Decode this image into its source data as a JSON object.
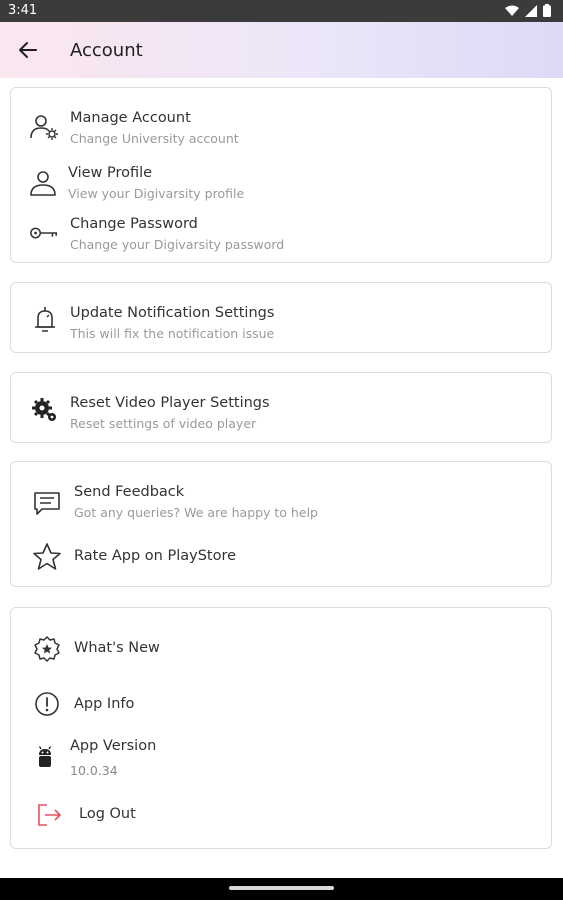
{
  "status": {
    "time": "3:41"
  },
  "header": {
    "title": "Account"
  },
  "account": {
    "items": [
      {
        "title": "Manage Account",
        "subtitle": "Change University account"
      },
      {
        "title": "View Profile",
        "subtitle": "View your Digivarsity profile"
      },
      {
        "title": "Change Password",
        "subtitle": "Change your Digivarsity password"
      }
    ]
  },
  "notification": {
    "title": "Update Notification Settings",
    "subtitle": "This will fix the notification issue"
  },
  "video": {
    "title": "Reset Video Player Settings",
    "subtitle": "Reset settings of video player"
  },
  "feedback": {
    "send": {
      "title": "Send Feedback",
      "subtitle": "Got any queries? We are happy to help"
    },
    "rate": {
      "title": "Rate App on PlayStore"
    }
  },
  "about": {
    "whats_new": "What's New",
    "app_info": "App Info",
    "app_version_label": "App Version",
    "app_version_value": "10.0.34",
    "logout": "Log Out"
  },
  "colors": {
    "logout": "#e8505b",
    "app_bar_start": "#fbe6ef",
    "app_bar_end": "#dcdaf6"
  }
}
